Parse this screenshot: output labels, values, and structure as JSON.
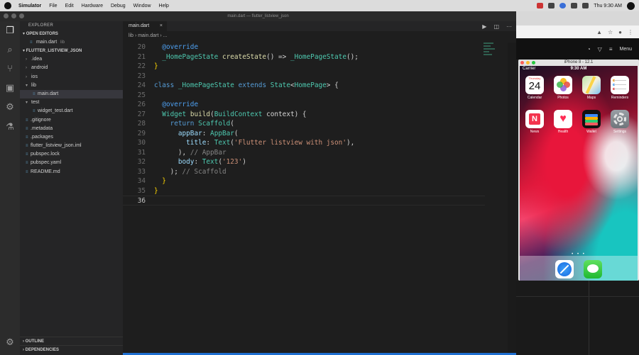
{
  "menubar": {
    "app": "Simulator",
    "items": [
      "File",
      "Edit",
      "Hardware",
      "Debug",
      "Window",
      "Help"
    ],
    "clock": "Thu 9:30 AM"
  },
  "window": {
    "title": "main.dart — flutter_listview_json"
  },
  "sidebar": {
    "header": "EXPLORER",
    "open_editors_label": "OPEN EDITORS",
    "open_editor_file": "main.dart",
    "open_editor_dir": "lib",
    "project_label": "FLUTTER_LISTVIEW_JSON",
    "tree": [
      {
        "label": ".idea",
        "type": "folder",
        "depth": 1
      },
      {
        "label": "android",
        "type": "folder",
        "depth": 1
      },
      {
        "label": "ios",
        "type": "folder",
        "depth": 1
      },
      {
        "label": "lib",
        "type": "folder-open",
        "depth": 1
      },
      {
        "label": "main.dart",
        "type": "file",
        "depth": 2
      },
      {
        "label": "test",
        "type": "folder-open",
        "depth": 1
      },
      {
        "label": "widget_test.dart",
        "type": "file",
        "depth": 2
      },
      {
        "label": ".gitignore",
        "type": "file",
        "depth": 1
      },
      {
        "label": ".metadata",
        "type": "file",
        "depth": 1
      },
      {
        "label": ".packages",
        "type": "file",
        "depth": 1
      },
      {
        "label": "flutter_listview_json.iml",
        "type": "file",
        "depth": 1
      },
      {
        "label": "pubspec.lock",
        "type": "file",
        "depth": 1
      },
      {
        "label": "pubspec.yaml",
        "type": "file",
        "depth": 1
      },
      {
        "label": "README.md",
        "type": "file",
        "depth": 1
      }
    ],
    "outline_label": "OUTLINE",
    "dependencies_label": "DEPENDENCIES"
  },
  "editor": {
    "tab_label": "main.dart",
    "breadcrumb": "lib › main.dart › ...",
    "lines": [
      {
        "n": "20",
        "tokens": [
          [
            "  ",
            "plain"
          ],
          [
            "@override",
            "anno"
          ]
        ]
      },
      {
        "n": "21",
        "tokens": [
          [
            "  ",
            "plain"
          ],
          [
            "_HomePageState",
            "cls"
          ],
          [
            " ",
            "plain"
          ],
          [
            "createState",
            "fn"
          ],
          [
            "() => ",
            "plain"
          ],
          [
            "_HomePageState",
            "cls"
          ],
          [
            "();",
            "plain"
          ]
        ]
      },
      {
        "n": "22",
        "tokens": [
          [
            "}",
            "yellow"
          ]
        ]
      },
      {
        "n": "23",
        "tokens": []
      },
      {
        "n": "24",
        "tokens": [
          [
            "class",
            "kw"
          ],
          [
            " ",
            "plain"
          ],
          [
            "_HomePageState",
            "cls"
          ],
          [
            " ",
            "plain"
          ],
          [
            "extends",
            "kw"
          ],
          [
            " ",
            "plain"
          ],
          [
            "State",
            "cls"
          ],
          [
            "<",
            "plain"
          ],
          [
            "HomePage",
            "cls"
          ],
          [
            "> {",
            "plain"
          ]
        ]
      },
      {
        "n": "25",
        "tokens": []
      },
      {
        "n": "26",
        "tokens": [
          [
            "  ",
            "plain"
          ],
          [
            "@override",
            "anno"
          ]
        ]
      },
      {
        "n": "27",
        "tokens": [
          [
            "  ",
            "plain"
          ],
          [
            "Widget",
            "cls"
          ],
          [
            " ",
            "plain"
          ],
          [
            "build",
            "fn"
          ],
          [
            "(",
            "plain"
          ],
          [
            "BuildContext",
            "cls"
          ],
          [
            " context) {",
            "plain"
          ]
        ]
      },
      {
        "n": "28",
        "tokens": [
          [
            "    ",
            "plain"
          ],
          [
            "return",
            "kw"
          ],
          [
            " ",
            "plain"
          ],
          [
            "Scaffold",
            "cls"
          ],
          [
            "(",
            "plain"
          ]
        ]
      },
      {
        "n": "29",
        "tokens": [
          [
            "      ",
            "plain"
          ],
          [
            "appBar",
            "param"
          ],
          [
            ": ",
            "plain"
          ],
          [
            "AppBar",
            "cls"
          ],
          [
            "(",
            "plain"
          ]
        ]
      },
      {
        "n": "30",
        "tokens": [
          [
            "        ",
            "plain"
          ],
          [
            "title",
            "param"
          ],
          [
            ": ",
            "plain"
          ],
          [
            "Text",
            "cls"
          ],
          [
            "(",
            "plain"
          ],
          [
            "'Flutter listview with json'",
            "str"
          ],
          [
            "),",
            "plain"
          ]
        ]
      },
      {
        "n": "31",
        "tokens": [
          [
            "      ",
            "plain"
          ],
          [
            "), ",
            "plain"
          ],
          [
            "// AppBar",
            "com"
          ]
        ]
      },
      {
        "n": "32",
        "tokens": [
          [
            "      ",
            "plain"
          ],
          [
            "body",
            "param"
          ],
          [
            ": ",
            "plain"
          ],
          [
            "Text",
            "cls"
          ],
          [
            "(",
            "plain"
          ],
          [
            "'123'",
            "str"
          ],
          [
            ")",
            "plain"
          ]
        ]
      },
      {
        "n": "33",
        "tokens": [
          [
            "    ",
            "plain"
          ],
          [
            "); ",
            "plain"
          ],
          [
            "// Scaffold",
            "com"
          ]
        ]
      },
      {
        "n": "34",
        "tokens": [
          [
            "  ",
            "plain"
          ],
          [
            "}",
            "yellow"
          ]
        ]
      },
      {
        "n": "35",
        "tokens": [
          [
            "}",
            "yellow"
          ]
        ]
      },
      {
        "n": "36",
        "tokens": [],
        "current": true
      }
    ]
  },
  "browser": {
    "menu_label": "Menu"
  },
  "simulator": {
    "title": "iPhone 8 - 12.1",
    "carrier": "Carrier",
    "time": "9:30 AM",
    "calendar_day": "Thursday",
    "calendar_date": "24",
    "news_glyph": "N",
    "health_glyph": "♥",
    "apps": [
      {
        "label": "Calendar",
        "icon": "calendar-icon"
      },
      {
        "label": "Photos",
        "icon": "photos-icon"
      },
      {
        "label": "Maps",
        "icon": "maps-icon"
      },
      {
        "label": "Reminders",
        "icon": "reminders-icon"
      },
      {
        "label": "News",
        "icon": "news-icon"
      },
      {
        "label": "Health",
        "icon": "health-icon"
      },
      {
        "label": "Wallet",
        "icon": "wallet-icon"
      },
      {
        "label": "Settings",
        "icon": "settings-icon"
      }
    ],
    "dock": [
      {
        "icon": "safari-icon"
      },
      {
        "icon": "messages-icon"
      }
    ],
    "page_dots": "• • •"
  }
}
